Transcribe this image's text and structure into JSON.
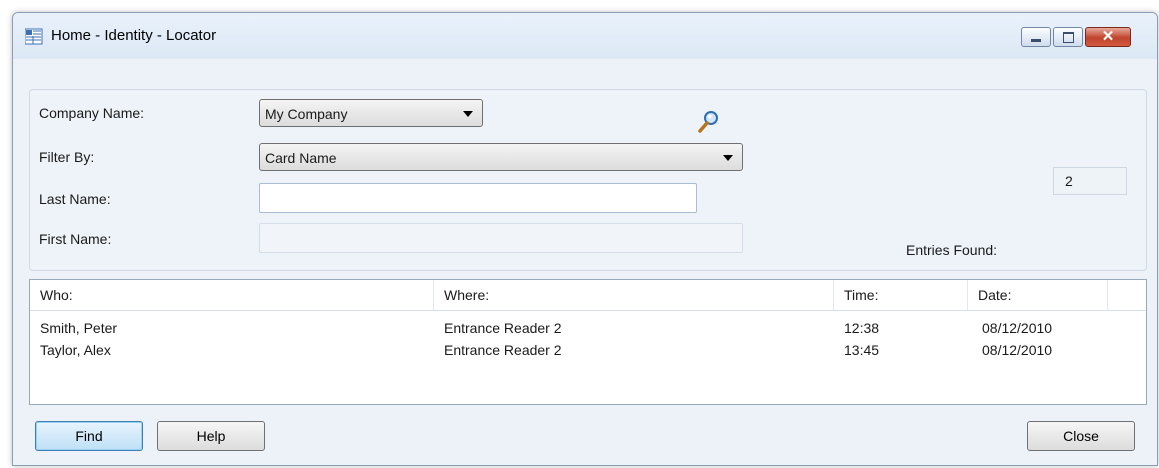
{
  "window": {
    "title": "Home - Identity - Locator",
    "close_glyph": "✕"
  },
  "filters": {
    "company_label": "Company Name:",
    "company_value": "My Company",
    "filter_by_label": "Filter By:",
    "filter_by_value": "Card Name",
    "last_name_label": "Last Name:",
    "last_name_value": "",
    "first_name_label": "First Name:",
    "first_name_value": "",
    "entries_found_label": "Entries Found:",
    "entries_found_value": "2"
  },
  "results": {
    "columns": [
      "Who:",
      "Where:",
      "Time:",
      "Date:"
    ],
    "rows": [
      {
        "who": "Smith, Peter",
        "where": "Entrance Reader 2",
        "time": "12:38",
        "date": "08/12/2010"
      },
      {
        "who": "Taylor, Alex",
        "where": "Entrance Reader 2",
        "time": "13:45",
        "date": "08/12/2010"
      }
    ]
  },
  "buttons": {
    "find": "Find",
    "help": "Help",
    "close": "Close"
  },
  "icons": {
    "app": "app-grid-icon",
    "search": "magnifier-icon"
  },
  "colors": {
    "default_button": "#bfe0f6",
    "close_button": "#c0442c"
  }
}
